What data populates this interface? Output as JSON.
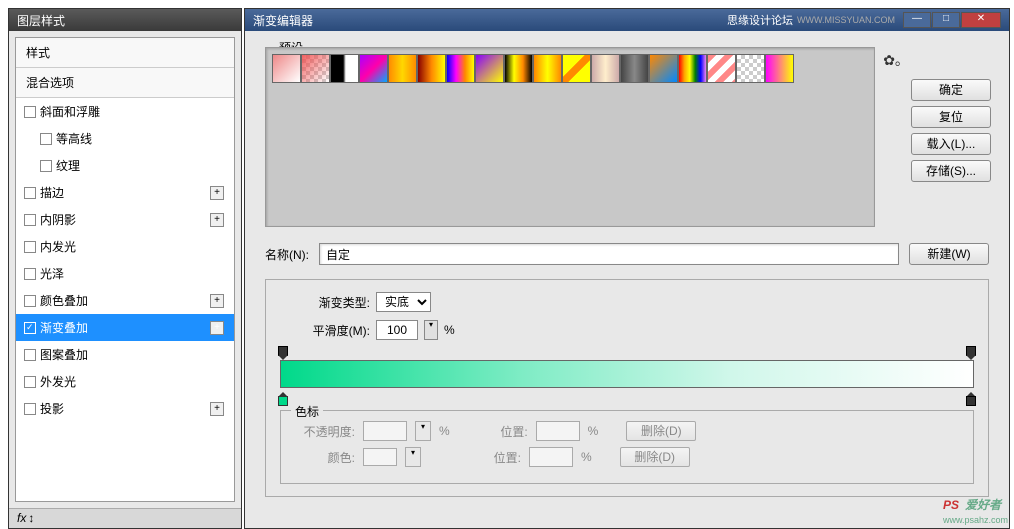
{
  "win1": {
    "title": "图层样式",
    "header1": "样式",
    "header2": "混合选项",
    "items": [
      {
        "label": "斜面和浮雕",
        "plus": false,
        "indent": false
      },
      {
        "label": "等高线",
        "plus": false,
        "indent": true
      },
      {
        "label": "纹理",
        "plus": false,
        "indent": true
      },
      {
        "label": "描边",
        "plus": true,
        "indent": false
      },
      {
        "label": "内阴影",
        "plus": true,
        "indent": false
      },
      {
        "label": "内发光",
        "plus": false,
        "indent": false
      },
      {
        "label": "光泽",
        "plus": false,
        "indent": false
      },
      {
        "label": "颜色叠加",
        "plus": true,
        "indent": false
      },
      {
        "label": "渐变叠加",
        "plus": true,
        "indent": false,
        "selected": true
      },
      {
        "label": "图案叠加",
        "plus": false,
        "indent": false
      },
      {
        "label": "外发光",
        "plus": false,
        "indent": false
      },
      {
        "label": "投影",
        "plus": true,
        "indent": false
      }
    ],
    "status_fx": "fx",
    "status_arrows": "↕"
  },
  "win2": {
    "title": "渐变编辑器",
    "brand": "思缘设计论坛",
    "url": "WWW.MISSYUAN.COM",
    "presets_label": "预设",
    "buttons": {
      "ok": "确定",
      "reset": "复位",
      "load": "载入(L)...",
      "save": "存储(S)..."
    },
    "name_label": "名称(N):",
    "name_value": "自定",
    "new_btn": "新建(W)",
    "grad_type_label": "渐变类型:",
    "grad_type_value": "实底",
    "smooth_label": "平滑度(M):",
    "smooth_value": "100",
    "percent": "%",
    "stops_label": "色标",
    "opacity_label": "不透明度:",
    "position_label": "位置:",
    "color_label": "颜色:",
    "delete_btn": "删除(D)",
    "gear": "✿｡"
  },
  "watermark": {
    "ps": "PS",
    "text": "爱好者",
    "url": "www.psahz.com"
  }
}
